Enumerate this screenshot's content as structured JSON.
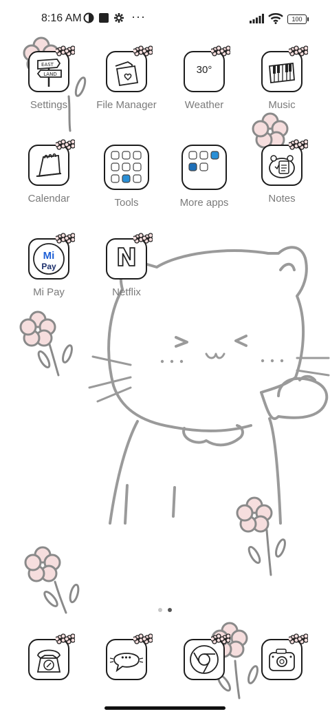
{
  "status_bar": {
    "time": "8:16 AM",
    "battery": "100",
    "more": "···"
  },
  "apps": [
    {
      "label": "Settings",
      "icon": "signpost-icon",
      "sign_top": "EAST",
      "sign_bottom": "LAND"
    },
    {
      "label": "File Manager",
      "icon": "folder-icon"
    },
    {
      "label": "Weather",
      "icon": "weather-icon",
      "temp": "30°"
    },
    {
      "label": "Music",
      "icon": "piano-icon"
    },
    {
      "label": "Calendar",
      "icon": "calendar-icon"
    },
    {
      "label": "Tools",
      "icon": "tools-folder-icon"
    },
    {
      "label": "More apps",
      "icon": "more-apps-folder-icon"
    },
    {
      "label": "Notes",
      "icon": "notes-icon"
    },
    {
      "label": "Mi Pay",
      "icon": "mi-pay-icon",
      "mi": "Mi",
      "pay": "Pay"
    },
    {
      "label": "Netflix",
      "icon": "netflix-icon",
      "letter": "N"
    }
  ],
  "dock": [
    {
      "name": "phone",
      "icon": "phone-icon"
    },
    {
      "name": "messages",
      "icon": "messages-icon",
      "text": "•••"
    },
    {
      "name": "chrome",
      "icon": "chrome-icon"
    },
    {
      "name": "camera",
      "icon": "camera-icon"
    }
  ],
  "pages": {
    "count": 2,
    "active": 2
  },
  "colors": {
    "flower": "#f6dede",
    "line": "#9a9a9a",
    "label": "#7a7a7a"
  }
}
